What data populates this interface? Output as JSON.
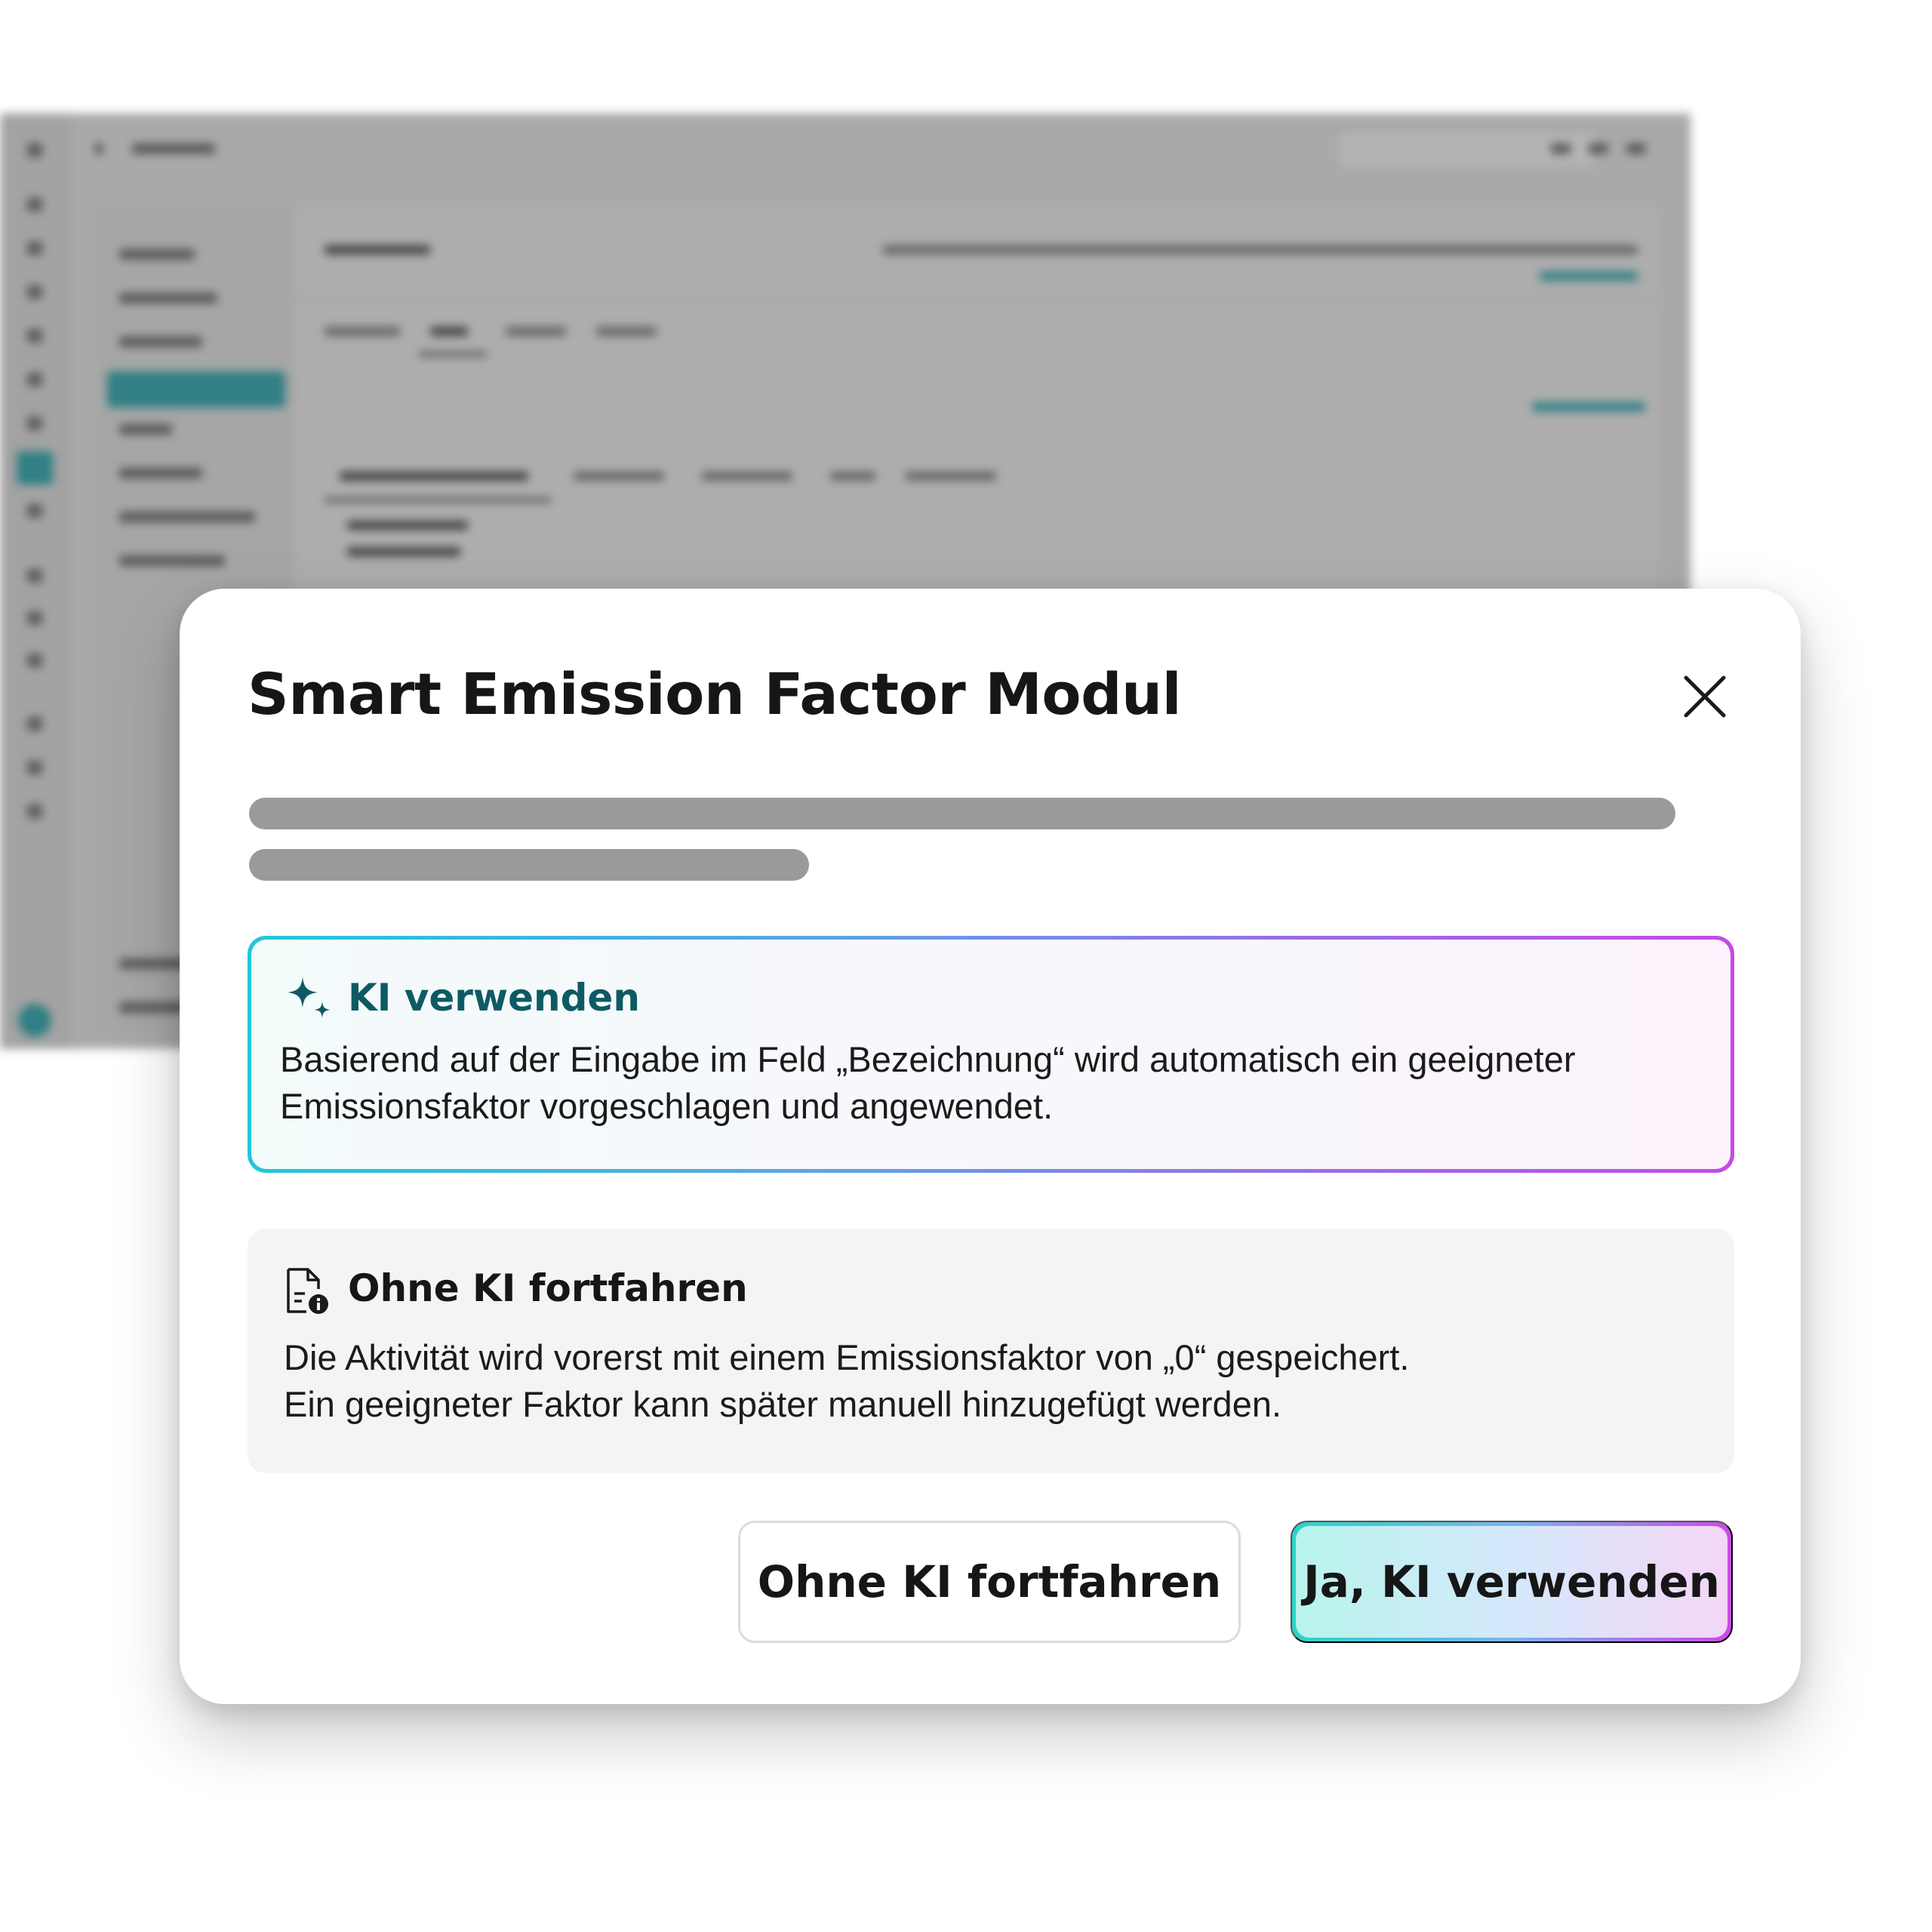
{
  "dialog": {
    "title": "Smart Emission Factor Modul",
    "close_icon": "close-icon"
  },
  "options": {
    "ai": {
      "icon": "sparkle-icon",
      "title": "KI verwenden",
      "description": "Basierend auf der Eingabe im Feld „Bezeichnung“ wird automatisch ein geeigneter Emissionsfaktor vorgeschlagen und angewendet.",
      "colors": {
        "gradient_start": "#20c7d8",
        "gradient_end": "#c549e4",
        "title": "#0e5a63"
      }
    },
    "manual": {
      "icon": "document-info-icon",
      "title": "Ohne KI fortfahren",
      "description_line1": "Die Aktivität wird vorerst mit einem Emissionsfaktor von „0“ gespeichert.",
      "description_line2": "Ein geeigneter Faktor kann später manuell hinzugefügt werden."
    }
  },
  "actions": {
    "secondary_label": "Ohne KI fortfahren",
    "primary_label": "Ja, KI verwenden"
  },
  "background_app": {
    "accent_color": "#2f7f84"
  }
}
